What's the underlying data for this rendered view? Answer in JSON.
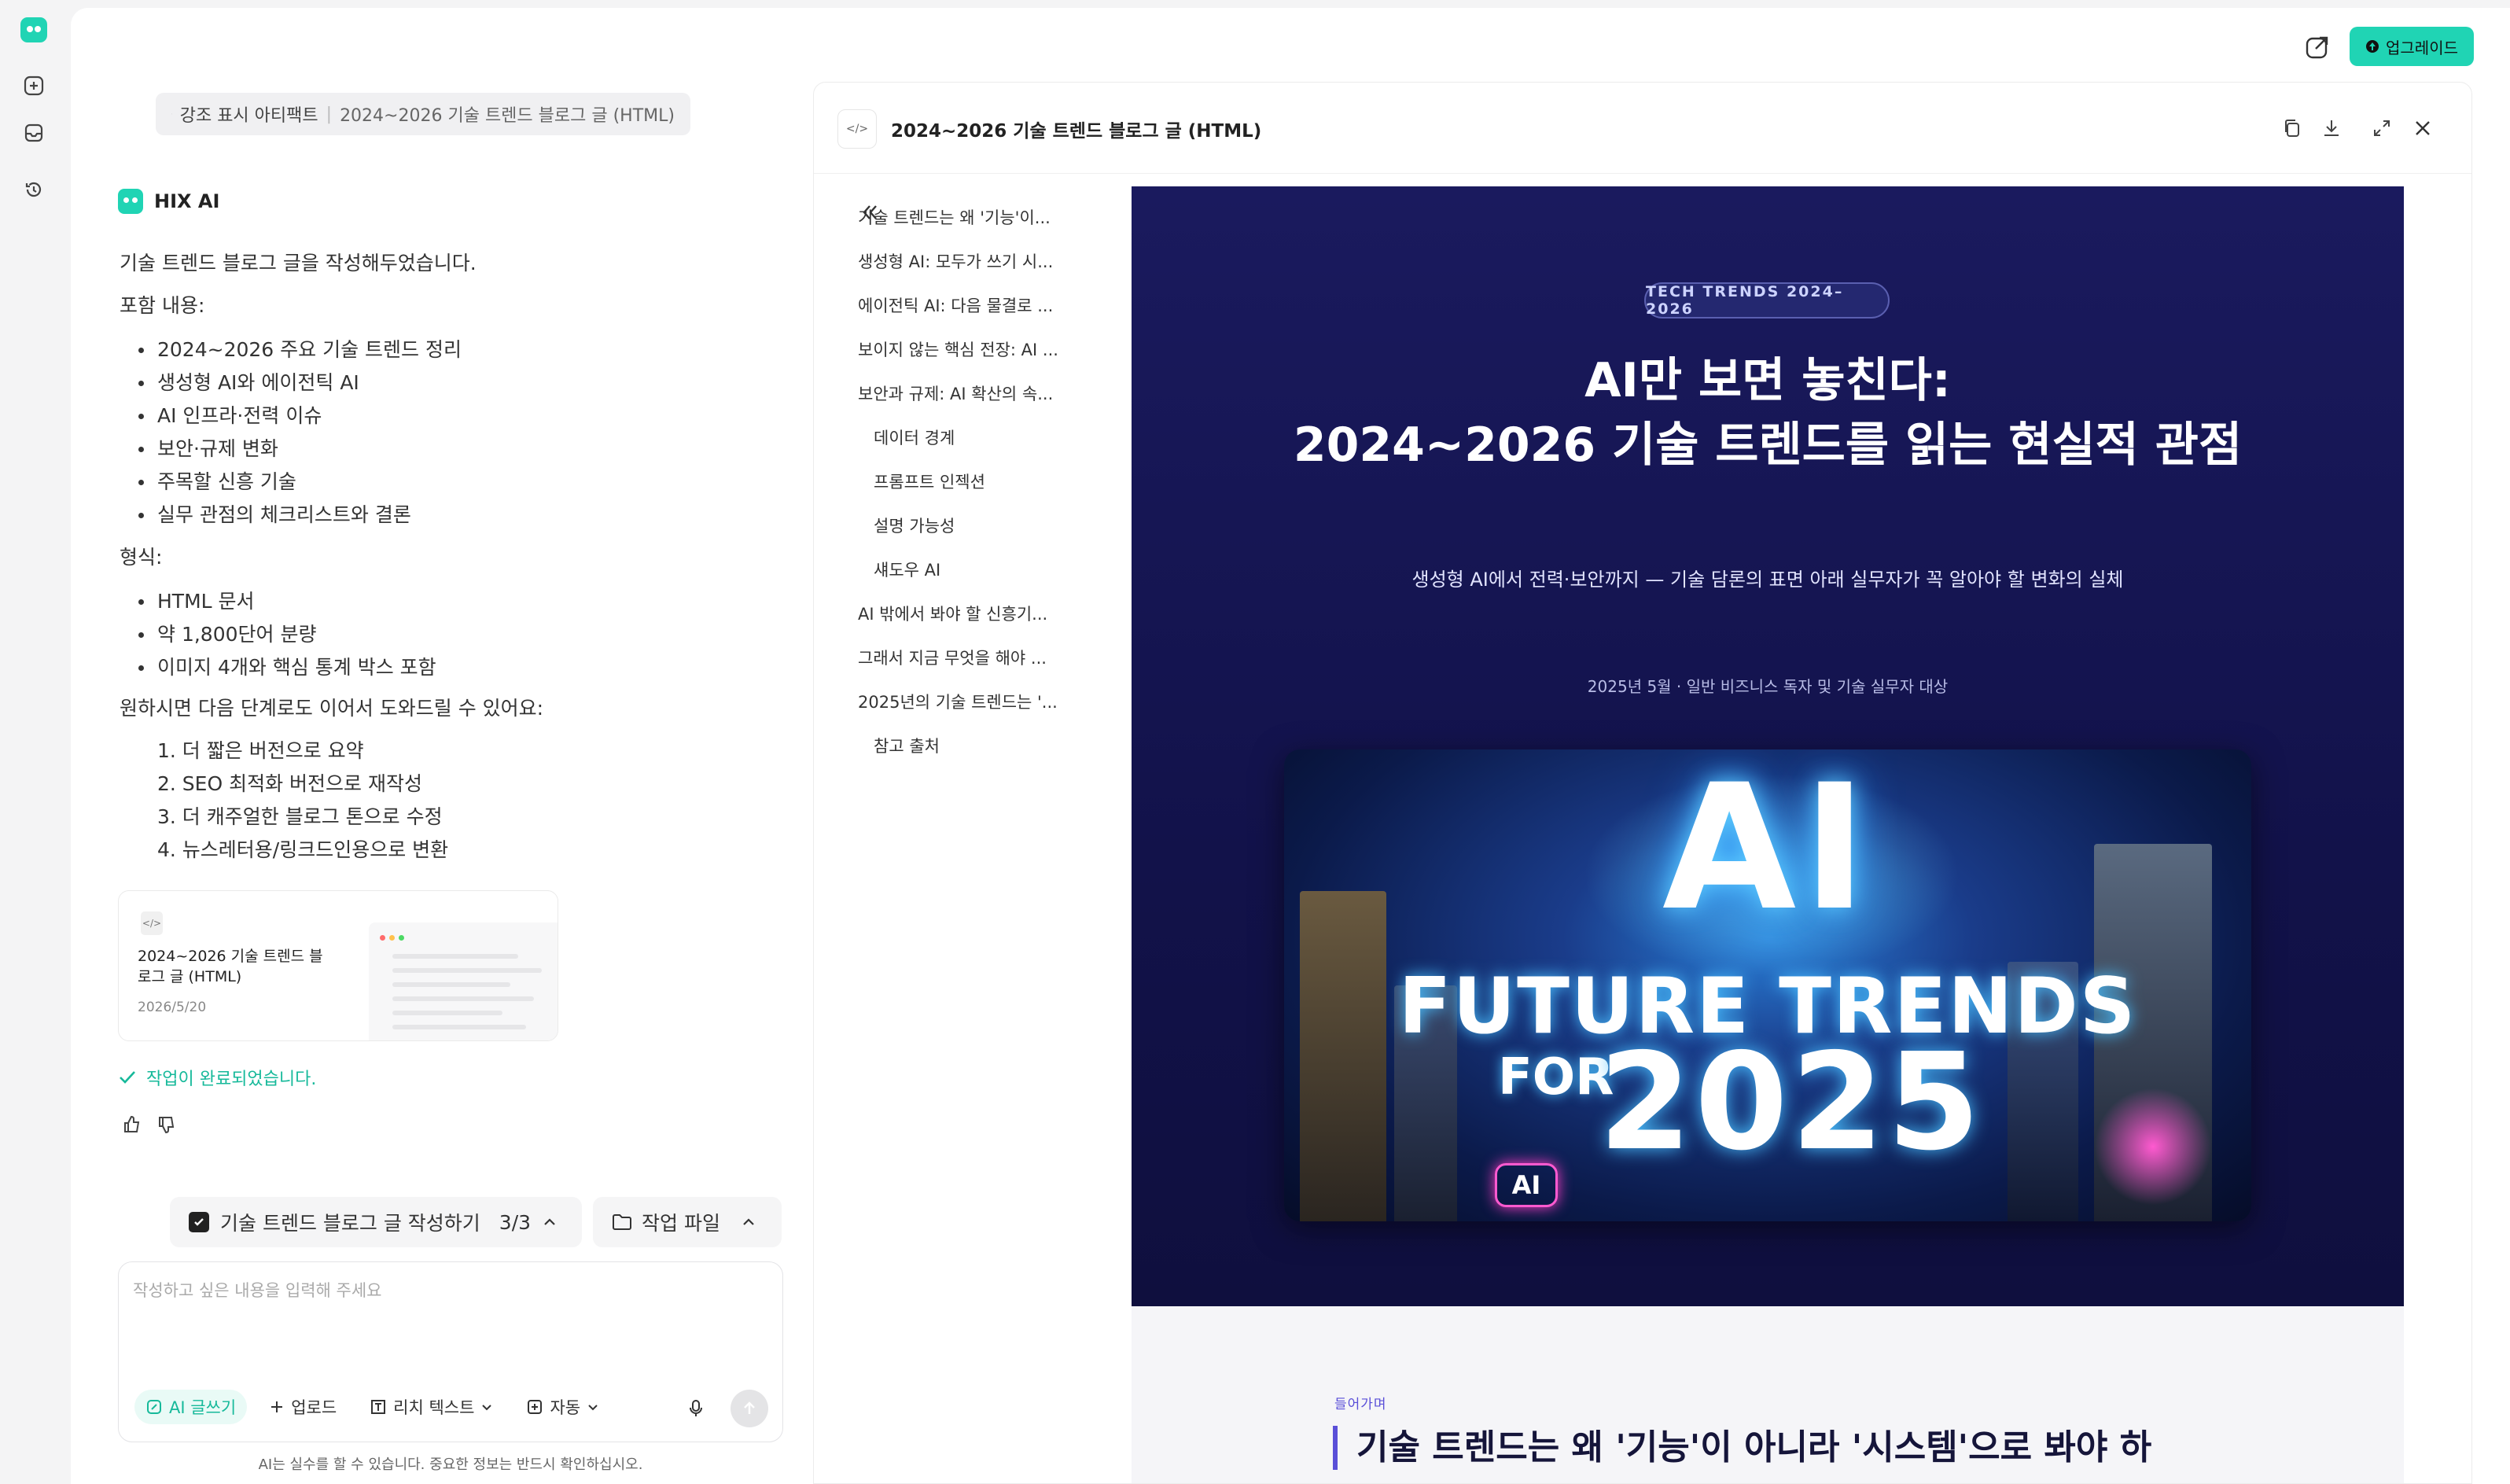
{
  "header": {
    "upgrade_label": "업그레이드"
  },
  "artifact_pill": {
    "label": "강조 표시 아티팩트",
    "title": "2024~2026 기술 트렌드 블로그 글 (HTML)"
  },
  "chat": {
    "assistant_name": "HIX AI",
    "intro": "기술 트렌드 블로그 글을 작성해두었습니다.",
    "includes_label": "포함 내용:",
    "includes": [
      "2024~2026 주요 기술 트렌드 정리",
      "생성형 AI와 에이전틱 AI",
      "AI 인프라·전력 이슈",
      "보안·규제 변화",
      "주목할 신흥 기술",
      "실무 관점의 체크리스트와 결론"
    ],
    "format_label": "형식:",
    "format": [
      "HTML 문서",
      "약 1,800단어 분량",
      "이미지 4개와 핵심 통계 박스 포함"
    ],
    "next_label": "원하시면 다음 단계로도 이어서 도와드릴 수 있어요:",
    "next": [
      "1. 더 짧은 버전으로 요약",
      "2. SEO 최적화 버전으로 재작성",
      "3. 더 캐주얼한 블로그 톤으로 수정",
      "4. 뉴스레터용/링크드인용으로 변환"
    ],
    "card": {
      "title": "2024~2026 기술 트렌드 블로그 글 (HTML)",
      "date": "2026/5/20"
    },
    "done": "작업이 완료되었습니다."
  },
  "task": {
    "label": "기술 트렌드 블로그 글 작성하기",
    "progress": "3/3",
    "files_label": "작업 파일"
  },
  "composer": {
    "placeholder": "작성하고 싶은 내용을 입력해 주세요",
    "ai_write": "AI 글쓰기",
    "upload": "업로드",
    "rich_text": "리치 텍스트",
    "auto": "자동",
    "disclaimer": "AI는 실수를 할 수 있습니다. 중요한 정보는 반드시 확인하십시오."
  },
  "panel": {
    "title": "2024~2026 기술 트렌드 블로그 글 (HTML)",
    "toc": [
      {
        "label": "기술 트렌드는 왜 '기능'이...",
        "indent": false
      },
      {
        "label": "생성형 AI: 모두가 쓰기 시...",
        "indent": false
      },
      {
        "label": "에이전틱 AI: 다음 물결로 ...",
        "indent": false
      },
      {
        "label": "보이지 않는 핵심 전장: AI ...",
        "indent": false
      },
      {
        "label": "보안과 규제: AI 확산의 속...",
        "indent": false
      },
      {
        "label": "데이터 경계",
        "indent": true
      },
      {
        "label": "프롬프트 인젝션",
        "indent": true
      },
      {
        "label": "설명 가능성",
        "indent": true
      },
      {
        "label": "섀도우 AI",
        "indent": true
      },
      {
        "label": "AI 밖에서 봐야 할 신흥기...",
        "indent": false
      },
      {
        "label": "그래서 지금 무엇을 해야 ...",
        "indent": false
      },
      {
        "label": "2025년의 기술 트렌드는 '...",
        "indent": false
      },
      {
        "label": "참고 출처",
        "indent": true
      }
    ]
  },
  "doc": {
    "badge": "TECH TRENDS 2024–2026",
    "title_line1": "AI만 보면 놓친다:",
    "title_line2": "2024~2026 기술 트렌드를 읽는 현실적 관점",
    "subtitle": "생성형 AI에서 전력·보안까지 — 기술 담론의 표면 아래 실무자가 꼭 알아야 할 변화의 실체",
    "meta": "2025년 5월 · 일반 비즈니스 독자 및 기술 실무자 대상",
    "image_ai": "AI",
    "image_future": "FUTURE TRENDS",
    "image_for": "FOR",
    "image_year": "2025",
    "image_badge": "AI",
    "section_kicker": "들어가며",
    "section_title": "기술 트렌드는 왜 '기능'이 아니라 '시스템'으로 봐야 하"
  },
  "colors": {
    "accent": "#20d4b4",
    "hero_bg": "#1a1a5e",
    "section_accent": "#5a4fd8"
  }
}
